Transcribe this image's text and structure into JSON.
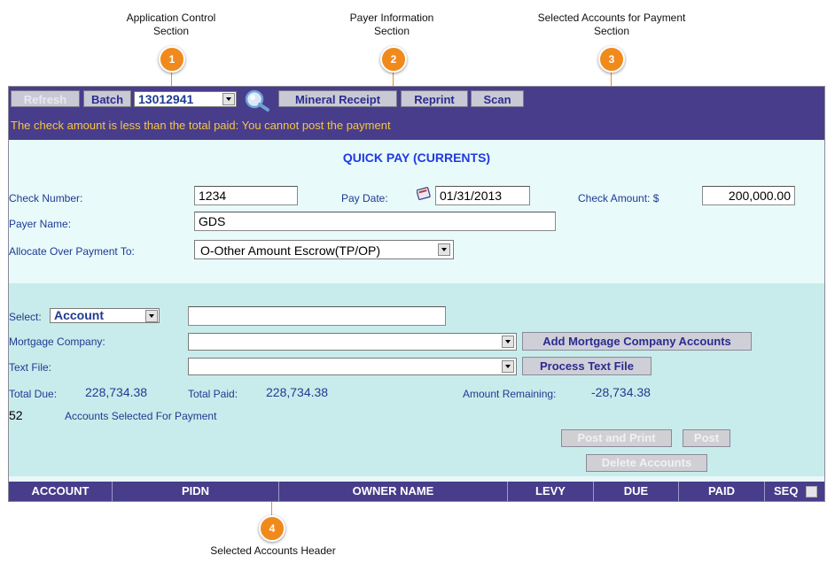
{
  "callouts": [
    {
      "num": "1",
      "label_line1": "Application Control",
      "label_line2": "Section"
    },
    {
      "num": "2",
      "label_line1": "Payer Information",
      "label_line2": "Section"
    },
    {
      "num": "3",
      "label_line1": "Selected Accounts for Payment",
      "label_line2": "Section"
    },
    {
      "num": "4",
      "label_line1": "Selected Accounts Header",
      "label_line2": ""
    }
  ],
  "toolbar": {
    "refresh_label": "Refresh",
    "batch_label": "Batch",
    "batch_value": "13012941",
    "mineral_receipt_label": "Mineral Receipt",
    "reprint_label": "Reprint",
    "scan_label": "Scan",
    "warning": "The check amount is less than the total paid: You cannot post the payment"
  },
  "payer": {
    "title": "QUICK PAY (CURRENTS)",
    "check_number_label": "Check Number:",
    "check_number_value": "1234",
    "pay_date_label": "Pay Date:",
    "pay_date_value": "01/31/2013",
    "check_amount_label": "Check Amount: $",
    "check_amount_value": "200,000.00",
    "payer_name_label": "Payer Name:",
    "payer_name_value": "GDS",
    "allocate_label": "Allocate Over Payment To:",
    "allocate_value": "O-Other Amount Escrow(TP/OP)"
  },
  "accounts": {
    "select_label": "Select:",
    "select_value": "Account",
    "mortgage_label": "Mortgage Company:",
    "add_mortgage_label": "Add Mortgage Company Accounts",
    "text_file_label": "Text File:",
    "process_text_label": "Process Text File",
    "total_due_label": "Total Due:",
    "total_due_value": "228,734.38",
    "total_paid_label": "Total Paid:",
    "total_paid_value": "228,734.38",
    "amount_remaining_label": "Amount Remaining:",
    "amount_remaining_value": "-28,734.38",
    "selected_count": "52",
    "selected_label": "Accounts Selected For Payment",
    "post_print_label": "Post and Print",
    "post_label": "Post",
    "delete_label": "Delete Accounts"
  },
  "header": {
    "columns": [
      "ACCOUNT",
      "PIDN",
      "OWNER NAME",
      "LEVY",
      "DUE",
      "PAID",
      "SEQ"
    ]
  },
  "colors": {
    "toolbar": "#483d8b",
    "accent": "#f08a1c",
    "warning": "#f5c542"
  }
}
